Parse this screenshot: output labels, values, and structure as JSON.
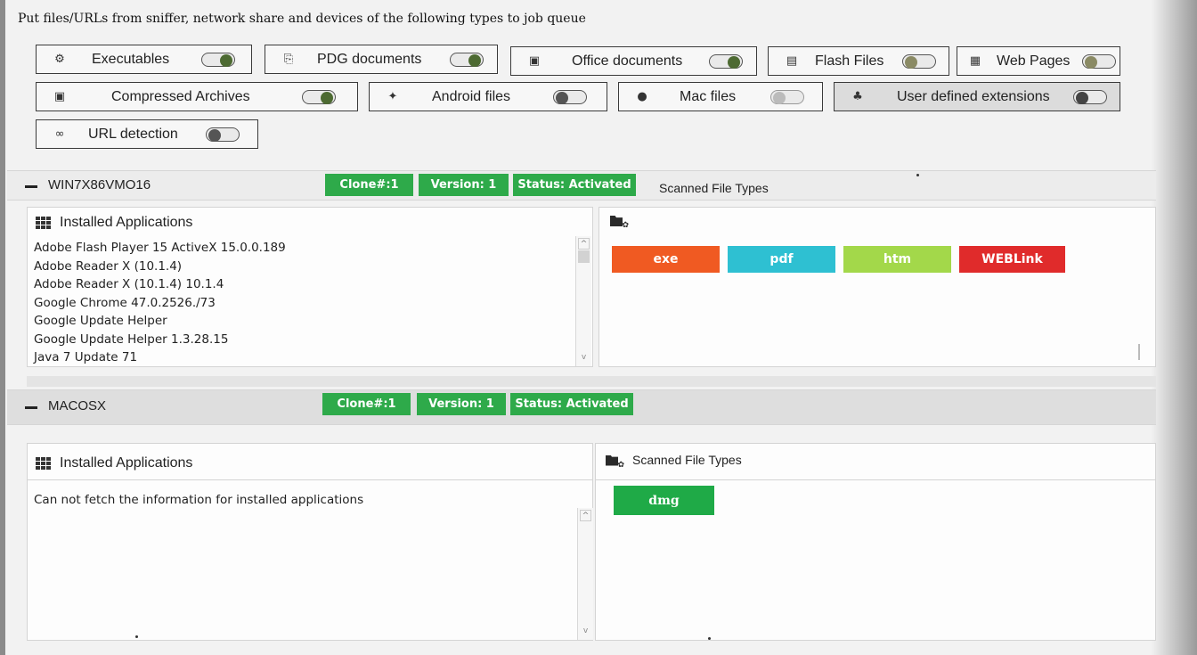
{
  "intro": "Put files/URLs from sniffer, network share and devices of the following types to job queue",
  "file_type_toggles": [
    {
      "label": "Executables",
      "icon": "cogs-icon",
      "state": "on"
    },
    {
      "label": "PDG documents",
      "icon": "pdf-icon",
      "state": "on"
    },
    {
      "label": "Office documents",
      "icon": "word-icon",
      "state": "on"
    },
    {
      "label": "Flash Files",
      "icon": "flash-icon",
      "state": "off"
    },
    {
      "label": "Web Pages",
      "icon": "web-icon",
      "state": "off"
    },
    {
      "label": "Compressed Archives",
      "icon": "archive-icon",
      "state": "on"
    },
    {
      "label": "Android files",
      "icon": "android-icon",
      "state": "off"
    },
    {
      "label": "Mac files",
      "icon": "apple-icon",
      "state": "off"
    },
    {
      "label": "User defined extensions",
      "icon": "user-add-icon",
      "state": "off"
    },
    {
      "label": "URL detection",
      "icon": "link-icon",
      "state": "off"
    }
  ],
  "devices": [
    {
      "name": "WIN7X86VMO16",
      "clone": "Clone#:1",
      "version": "Version: 1",
      "status": "Status: Activated",
      "scanned_header": "Scanned File Types",
      "installed_title": "Installed Applications",
      "applications": [
        "Adobe Flash Player 15 ActiveX 15.0.0.189",
        "Adobe Reader X (10.1.4)",
        "Adobe Reader X (10.1.4) 10.1.4",
        "Google Chrome 47.0.2526./73",
        "Google Update Helper",
        "Google Update Helper 1.3.28.15",
        "Java 7 Update 71"
      ],
      "file_types": [
        {
          "label": "exe",
          "color": "#f05a22"
        },
        {
          "label": "pdf",
          "color": "#2ec0d2"
        },
        {
          "label": "htm",
          "color": "#a3d84a"
        },
        {
          "label": "WEBLink",
          "color": "#e02b2b"
        }
      ]
    },
    {
      "name": "MACOSX",
      "clone": "Clone#:1",
      "version": "Version: 1",
      "status": "Status: Activated",
      "installed_title": "Installed Applications",
      "scanned_title": "Scanned File Types",
      "message": "Can not fetch the information for installed applications",
      "file_types": [
        {
          "label": "dmg",
          "color": "#1faa47"
        }
      ]
    }
  ],
  "colors": {
    "badge": "#2eaa4a",
    "toggle_on": "#4d6a32"
  }
}
